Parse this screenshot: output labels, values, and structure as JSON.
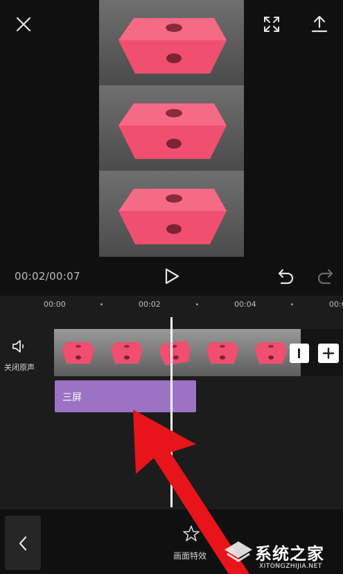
{
  "header": {
    "close_icon": "close-icon",
    "fullscreen_icon": "fullscreen-icon",
    "export_icon": "export-icon"
  },
  "playback": {
    "time": "00:02/00:07",
    "play_icon": "play-icon",
    "undo_icon": "undo-icon",
    "redo_icon": "redo-icon"
  },
  "ruler": {
    "ticks": [
      "00:00",
      "00:02",
      "00:04",
      "00:0"
    ]
  },
  "audio": {
    "mute_label": "关闭原声",
    "icon": "speaker-icon"
  },
  "effect_track": {
    "label": "三屏"
  },
  "bottom_bar": {
    "back_icon": "back-chevron-icon",
    "effect_label": "画面特效",
    "effect_icon": "star-icon"
  },
  "watermark": {
    "title": "系统之家",
    "url": "XITONGZHIJIA.NET"
  },
  "colors": {
    "accent_purple": "#9c73c4",
    "block_pink": "#f04f70",
    "arrow_red": "#e8141b"
  }
}
